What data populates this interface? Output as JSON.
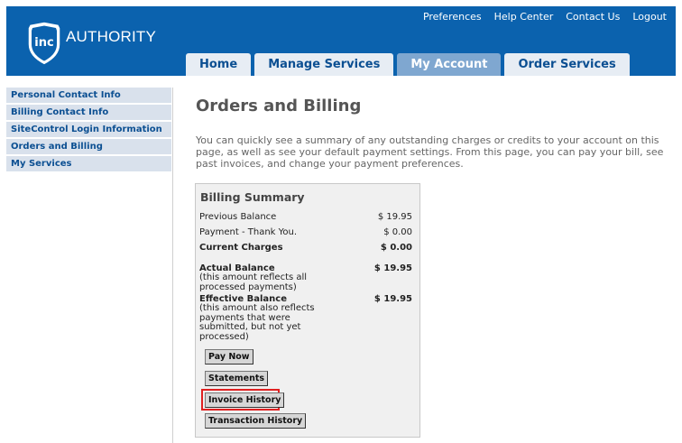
{
  "top_links": [
    "Preferences",
    "Help Center",
    "Contact Us",
    "Logout"
  ],
  "logo": {
    "badge_text": "inc",
    "text": "AUTHORITY"
  },
  "tabs": [
    {
      "label": "Home",
      "active": false
    },
    {
      "label": "Manage Services",
      "active": false
    },
    {
      "label": "My Account",
      "active": true
    },
    {
      "label": "Order Services",
      "active": false
    }
  ],
  "sidebar": {
    "items": [
      {
        "label": "Personal Contact Info"
      },
      {
        "label": "Billing Contact Info"
      },
      {
        "label": "SiteControl Login Information"
      },
      {
        "label": "Orders and Billing"
      },
      {
        "label": "My Services"
      }
    ]
  },
  "main": {
    "title": "Orders and Billing",
    "intro": "You can quickly see a summary of any outstanding charges or credits to your account on this page, as well as see your default payment settings. From this page, you can pay your bill, see past invoices, and change your payment preferences."
  },
  "billing": {
    "title": "Billing Summary",
    "previous_balance_label": "Previous Balance",
    "previous_balance": "$ 19.95",
    "payment_label": "Payment - Thank You.",
    "payment": "$ 0.00",
    "current_charges_label": "Current Charges",
    "current_charges": "$ 0.00",
    "actual_balance_label": "Actual Balance",
    "actual_balance_note": "(this amount reflects all processed payments)",
    "actual_balance": "$ 19.95",
    "effective_balance_label": "Effective Balance",
    "effective_balance_note": "(this amount also reflects payments that were submitted, but not yet processed)",
    "effective_balance": "$ 19.95"
  },
  "buttons": {
    "pay_now": "Pay Now",
    "statements": "Statements",
    "invoice_history": "Invoice History",
    "transaction_history": "Transaction History"
  },
  "colors": {
    "header": "#0b62ae",
    "tab_active": "#7fa7d0",
    "highlight": "#e02020"
  }
}
